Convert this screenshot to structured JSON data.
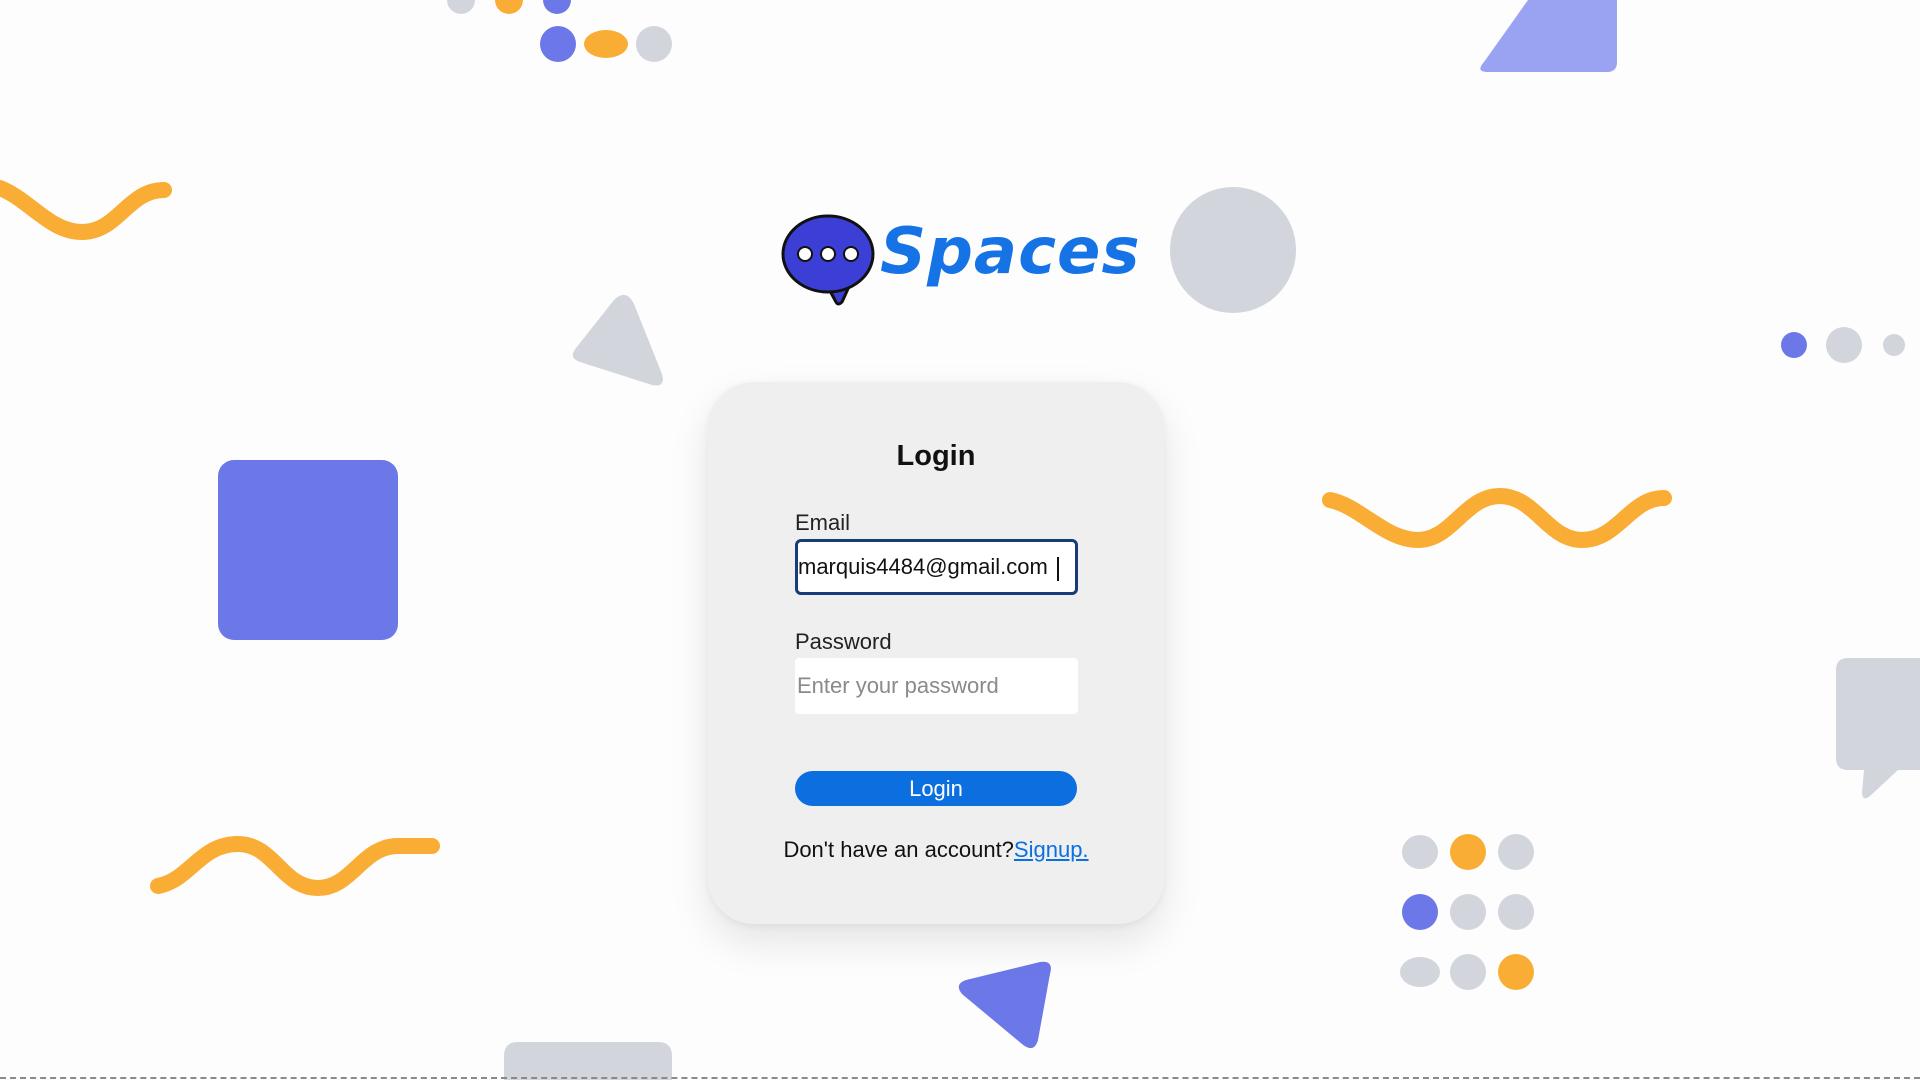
{
  "app": {
    "name": "Spaces"
  },
  "logo": {
    "text": "Spaces",
    "icon": "chat-bubble-icon",
    "bubble_color": "#3b3fd6",
    "text_color": "#1673e6"
  },
  "login_form": {
    "title": "Login",
    "email_label": "Email",
    "email_value": "marquis4484@gmail.com",
    "password_label": "Password",
    "password_placeholder": "Enter your password",
    "submit_label": "Login",
    "signup_prompt": "Don't have an account?",
    "signup_link_label": "Signup."
  },
  "colors": {
    "accent_blue": "#0b6fe0",
    "purple": "#6c78e8",
    "orange": "#f9ad35",
    "gray": "#d3d5dd",
    "card_background": "#efefef"
  }
}
